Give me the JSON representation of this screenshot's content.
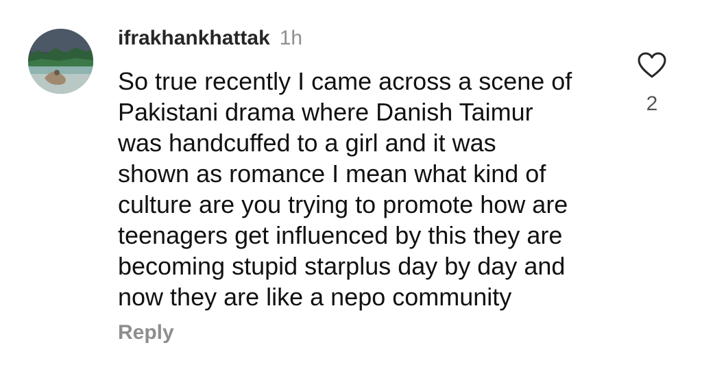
{
  "comment": {
    "username": "ifrakhankhattak",
    "timestamp": "1h",
    "text_lines": [
      "So true recently I came across a scene of",
      "Pakistani drama where Danish Taimur",
      "was handcuffed to a girl and it was",
      "shown as romance I mean what kind of",
      "culture are you trying to promote how are",
      "teenagers get influenced by this they are",
      "becoming stupid starplus day by day and",
      "now they are like a nepo community"
    ],
    "reply_label": "Reply",
    "like_count": "2",
    "like_icon": "heart-outline-icon"
  },
  "colors": {
    "username": "#262626",
    "secondary_text": "#8e8e8e",
    "body_text": "#111111",
    "background": "#ffffff"
  }
}
